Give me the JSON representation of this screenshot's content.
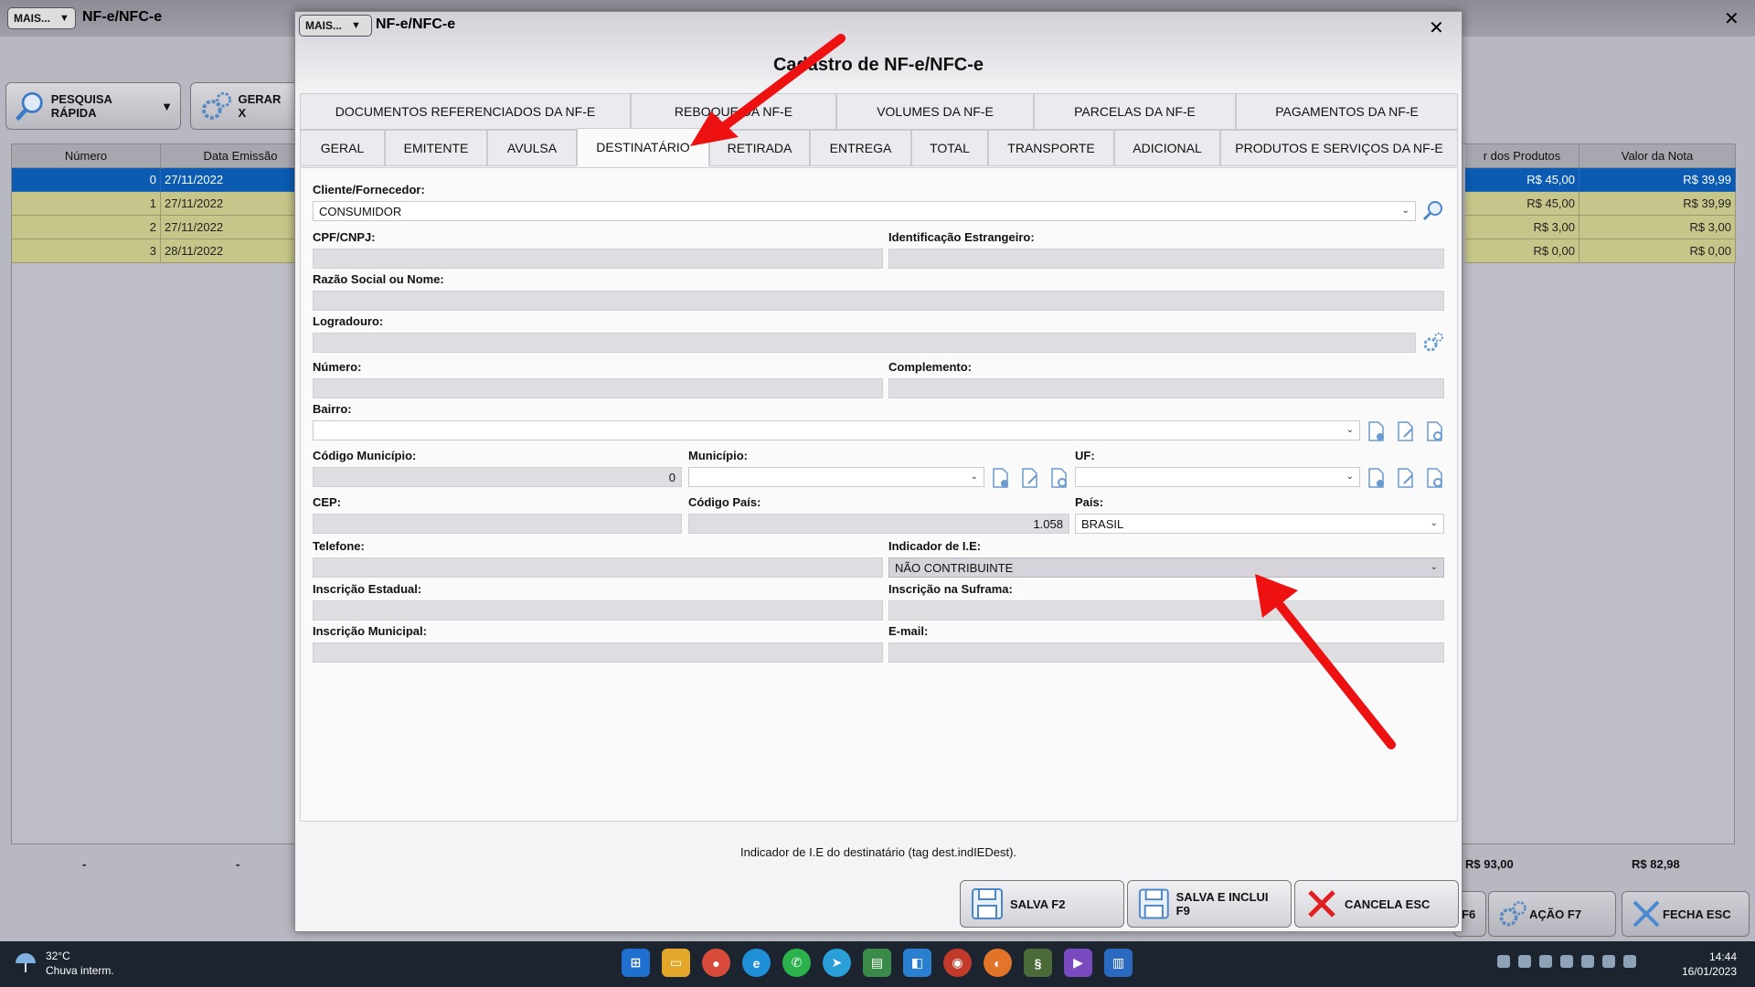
{
  "background_window": {
    "more_button": "MAIS...",
    "title": "NF-e/NFC-e",
    "close": "✕",
    "toolbar": {
      "quick_search": "PESQUISA RÁPIDA",
      "generate": "GERAR X"
    },
    "grid": {
      "columns": [
        "Número",
        "Data Emissão",
        "r dos Produtos",
        "Valor da Nota"
      ],
      "rows": [
        {
          "numero": "0",
          "data": "27/11/2022",
          "produtos": "R$ 45,00",
          "valor": "R$ 39,99",
          "selected": true
        },
        {
          "numero": "1",
          "data": "27/11/2022",
          "produtos": "R$ 45,00",
          "valor": "R$ 39,99"
        },
        {
          "numero": "2",
          "data": "27/11/2022",
          "produtos": "R$ 3,00",
          "valor": "R$ 3,00"
        },
        {
          "numero": "3",
          "data": "28/11/2022",
          "produtos": "R$ 0,00",
          "valor": "R$ 0,00"
        }
      ],
      "footer": {
        "c1": "-",
        "c2": "-",
        "total_produtos": "R$ 93,00",
        "total_nota": "R$ 82,98"
      }
    },
    "bottom_buttons": {
      "f6": "F6",
      "acao": "AÇÃO F7",
      "fecha": "FECHA ESC"
    }
  },
  "dialog": {
    "more_button": "MAIS...",
    "title": "NF-e/NFC-e",
    "close": "✕",
    "heading": "Cadastro de NF-e/NFC-e",
    "tabs_row1": [
      "DOCUMENTOS REFERENCIADOS DA NF-E",
      "REBOQUE DA NF-E",
      "VOLUMES DA NF-E",
      "PARCELAS DA NF-E",
      "PAGAMENTOS DA NF-E"
    ],
    "tabs_row2": [
      "GERAL",
      "EMITENTE",
      "AVULSA",
      "DESTINATÁRIO",
      "RETIRADA",
      "ENTREGA",
      "TOTAL",
      "TRANSPORTE",
      "ADICIONAL",
      "PRODUTOS E SERVIÇOS DA NF-E"
    ],
    "active_tab": "DESTINATÁRIO",
    "form": {
      "cliente_label": "Cliente/Fornecedor:",
      "cliente_value": "CONSUMIDOR",
      "cpf_label": "CPF/CNPJ:",
      "cpf_value": "",
      "id_estrangeiro_label": "Identificação Estrangeiro:",
      "id_estrangeiro_value": "",
      "razao_label": "Razão Social ou Nome:",
      "razao_value": "",
      "logradouro_label": "Logradouro:",
      "logradouro_value": "",
      "numero_label": "Número:",
      "numero_value": "",
      "complemento_label": "Complemento:",
      "complemento_value": "",
      "bairro_label": "Bairro:",
      "bairro_value": "",
      "cod_municipio_label": "Código Município:",
      "cod_municipio_value": "0",
      "municipio_label": "Município:",
      "municipio_value": "",
      "uf_label": "UF:",
      "uf_value": "",
      "cep_label": "CEP:",
      "cep_value": "",
      "cod_pais_label": "Código País:",
      "cod_pais_value": "1.058",
      "pais_label": "País:",
      "pais_value": "BRASIL",
      "telefone_label": "Telefone:",
      "telefone_value": "",
      "ind_ie_label": "Indicador de I.E:",
      "ind_ie_value": "NÃO CONTRIBUINTE",
      "insc_estadual_label": "Inscrição Estadual:",
      "insc_estadual_value": "",
      "insc_suframa_label": "Inscrição na Suframa:",
      "insc_suframa_value": "",
      "insc_municipal_label": "Inscrição Municipal:",
      "insc_municipal_value": "",
      "email_label": "E-mail:",
      "email_value": ""
    },
    "hint": "Indicador de I.E do destinatário (tag dest.indIEDest).",
    "buttons": {
      "save": "SALVA F2",
      "save_include": "SALVA E INCLUI F9",
      "cancel": "CANCELA ESC"
    }
  },
  "taskbar": {
    "temperature": "32°C",
    "weather": "Chuva interm.",
    "time": "14:44",
    "date": "16/01/2023"
  },
  "colors": {
    "selection": "#0b5bb3",
    "row_highlight": "#ffff99",
    "annotation_arrow": "#ee1111"
  }
}
